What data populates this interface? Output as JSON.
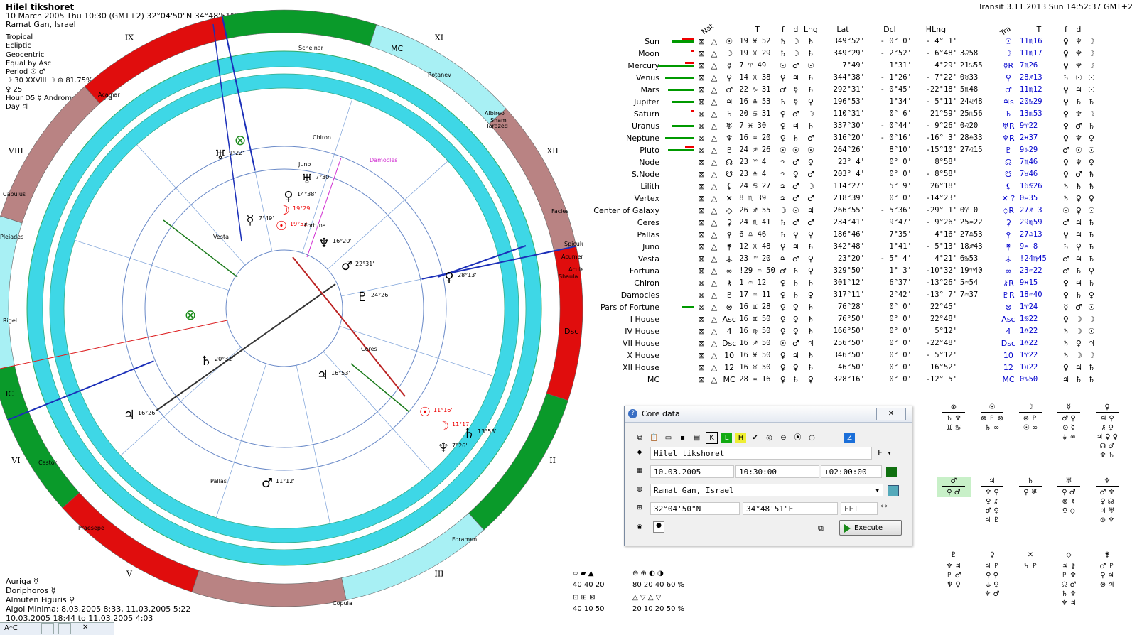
{
  "header": {
    "name": "Hilel tikshoret",
    "datetime": "10 March 2005   Thu   10:30 (GMT+2) 32°04'50\"N   34°48'51\"E",
    "place": "Ramat Gan, Israel"
  },
  "settings": [
    "Tropical",
    "Ecliptic",
    "Geocentric",
    "Equal by Asc",
    "Period ☉ ♂",
    "☽ 30 XXVIII ☽ ⊕ 81.75%",
    "♀ 25",
    "Hour D5 ☿ Andromeda Nebula",
    "Day ♃"
  ],
  "transit_label": "Transit  3.11.2013  Sun 14:52:37 GMT+2",
  "bottom_info": [
    "Auriga ☿",
    "Doriphoros ☿",
    "Almuten Figuris ♀",
    "Algol Minima: 8.03.2005  8:33,  11.03.2005  5:22",
    "10.03.2005 18:44 to 11.03.2005  4:03"
  ],
  "taskbar_label": "A*C",
  "chart": {
    "house_labels": [
      "X",
      "XI",
      "XII",
      "I",
      "II",
      "III",
      "IV",
      "V",
      "VI",
      "VII",
      "VIII",
      "IX"
    ],
    "angle_labels": {
      "mc": "MC",
      "ic": "IC",
      "dsc": "Dsc"
    },
    "planets": [
      {
        "glyph": "☉",
        "deg": "19°52'",
        "color": "#e00"
      },
      {
        "glyph": "☽",
        "deg": "19°29'",
        "color": "#e00"
      },
      {
        "glyph": "☿",
        "deg": "7°49'",
        "color": "#000"
      },
      {
        "glyph": "♀",
        "deg": "14°38'",
        "color": "#000"
      },
      {
        "glyph": "♂",
        "deg": "22°31'",
        "color": "#000"
      },
      {
        "glyph": "♃",
        "deg": "16°53'",
        "color": "#000"
      },
      {
        "glyph": "♄",
        "deg": "20°31'",
        "color": "#000"
      },
      {
        "glyph": "♅",
        "deg": "7°30'",
        "color": "#000"
      },
      {
        "glyph": "♆",
        "deg": "16°20'",
        "color": "#000"
      },
      {
        "glyph": "♇",
        "deg": "24°26'",
        "color": "#000"
      }
    ],
    "transits": [
      {
        "glyph": "☉",
        "deg": "11°16'",
        "color": "#e00"
      },
      {
        "glyph": "☽",
        "deg": "11°17'",
        "color": "#e00"
      },
      {
        "glyph": "♄",
        "deg": "13°53'",
        "color": "#000"
      },
      {
        "glyph": "♀",
        "deg": "28°13'",
        "color": "#000"
      },
      {
        "glyph": "♃",
        "deg": "16°26'",
        "color": "#000"
      },
      {
        "glyph": "♂",
        "deg": "11°12'",
        "color": "#000"
      },
      {
        "glyph": "♆",
        "deg": "7°26'",
        "color": "#000"
      },
      {
        "glyph": "♅",
        "deg": "9°22'",
        "color": "#000"
      }
    ],
    "points": [
      "Chiron",
      "Juno",
      "Damocles",
      "Vesta",
      "Fortuna",
      "Pallas",
      "Ceres",
      "Acamar",
      "Scheinar",
      "Rotanev",
      "Albireo",
      "Sham",
      "Tarazed",
      "Facies",
      "Spiculum",
      "Acumen",
      "Aculeus",
      "Shaula",
      "Capulus",
      "Pleiades",
      "Rigel",
      "Castor",
      "Praesepe",
      "Foramen",
      "Copula"
    ]
  },
  "table": {
    "headers": {
      "nat": "Nat",
      "t": "T",
      "f": "f",
      "d": "d",
      "lng": "Lng",
      "lat": "Lat",
      "dcl": "Dcl",
      "hlng": "HLng",
      "tra": "Tra",
      "t2": "T",
      "f2": "f",
      "d2": "d"
    },
    "rows": [
      {
        "name": "Sun",
        "g": "☉",
        "lng": "19 ♓ 52",
        "t": "♄",
        "f": "☽",
        "d": "♄",
        "elng": "349°52'",
        "lat": "- 0° 0'",
        "dcl": "- 4° 1'",
        "hl": "",
        "tg": "☉",
        "tr": "11♏16",
        "t2": "♀",
        "f2": "♆",
        "d2": "☽",
        "gr": 30,
        "rd": 16
      },
      {
        "name": "Moon",
        "g": "☽",
        "lng": "19 ♓ 29",
        "t": "♄",
        "f": "☽",
        "d": "♄",
        "elng": "349°29'",
        "lat": "- 2°52'",
        "dcl": "- 6°48'",
        "hl": "3♌58",
        "tg": "☽",
        "tr": "11♏17",
        "t2": "♀",
        "f2": "♆",
        "d2": "☽",
        "gr": 0,
        "rd": 3
      },
      {
        "name": "Mercury",
        "g": "☿",
        "lng": "7 ♈ 49",
        "t": "☉",
        "f": "♂",
        "d": "☉",
        "elng": "7°49'",
        "lat": "1°31'",
        "dcl": "4°29'",
        "hl": "21♋55",
        "tg": "☿R",
        "tr": "7♏26",
        "t2": "♀",
        "f2": "♆",
        "d2": "☽",
        "gr": 50,
        "rd": 12
      },
      {
        "name": "Venus",
        "g": "♀",
        "lng": "14 ♓ 38",
        "t": "♀",
        "f": "♃",
        "d": "♄",
        "elng": "344°38'",
        "lat": "- 1°26'",
        "dcl": "- 7°22'",
        "hl": "0♉33",
        "tg": "♀",
        "tr": "28♐13",
        "t2": "♄",
        "f2": "☉",
        "d2": "☉",
        "gr": 40,
        "rd": 0
      },
      {
        "name": "Mars",
        "g": "♂",
        "lng": "22 ♑ 31",
        "t": "♂",
        "f": "☿",
        "d": "♄",
        "elng": "292°31'",
        "lat": "- 0°45'",
        "dcl": "-22°18'",
        "hl": "5♏48",
        "tg": "♂",
        "tr": "11♍12",
        "t2": "♀",
        "f2": "♃",
        "d2": "☉",
        "gr": 36,
        "rd": 0
      },
      {
        "name": "Jupiter",
        "g": "♃",
        "lng": "16 ♎ 53",
        "t": "♄",
        "f": "☿",
        "d": "♀",
        "elng": "196°53'",
        "lat": "1°34'",
        "dcl": "- 5°11'",
        "hl": "24♌48",
        "tg": "♃s",
        "tr": "20♋29",
        "t2": "♀",
        "f2": "♄",
        "d2": "♄",
        "gr": 30,
        "rd": 0
      },
      {
        "name": "Saturn",
        "g": "♄",
        "lng": "20 ♋ 31",
        "t": "♀",
        "f": "♂",
        "d": "☽",
        "elng": "110°31'",
        "lat": "0° 6'",
        "dcl": "21°59'",
        "hl": "25♏56",
        "tg": "♄",
        "tr": "13♏53",
        "t2": "♀",
        "f2": "♆",
        "d2": "☽",
        "gr": 0,
        "rd": 4
      },
      {
        "name": "Uranus",
        "g": "♅",
        "lng": "7 ♓ 30",
        "t": "♀",
        "f": "♃",
        "d": "♄",
        "elng": "337°30'",
        "lat": "- 0°44'",
        "dcl": "- 9°26'",
        "hl": "0♌20",
        "tg": "♅R",
        "tr": "9♈22",
        "t2": "♀",
        "f2": "♂",
        "d2": "♄",
        "gr": 30,
        "rd": 0
      },
      {
        "name": "Neptune",
        "g": "♆",
        "lng": "16 ♒ 20",
        "t": "♀",
        "f": "♄",
        "d": "♂",
        "elng": "316°20'",
        "lat": "- 0°16'",
        "dcl": "-16° 3'",
        "hl": "28♎33",
        "tg": "♆R",
        "tr": "2♓37",
        "t2": "♀",
        "f2": "♆",
        "d2": "♀",
        "gr": 40,
        "rd": 0
      },
      {
        "name": "Pluto",
        "g": "♇",
        "lng": "24 ♐ 26",
        "t": "☉",
        "f": "☉",
        "d": "☉",
        "elng": "264°26'",
        "lat": "8°10'",
        "dcl": "-15°10'",
        "hl": "27♌15",
        "tg": "♇",
        "tr": "9♑29",
        "t2": "♂",
        "f2": "☉",
        "d2": "☉",
        "gr": 36,
        "rd": 12
      },
      {
        "name": "Node",
        "g": "☊",
        "lng": "23 ♈ 4",
        "t": "♃",
        "f": "♂",
        "d": "♀",
        "elng": "23° 4'",
        "lat": "0° 0'",
        "dcl": "8°58'",
        "hl": "",
        "tg": "☊",
        "tr": "7♏46",
        "t2": "♀",
        "f2": "♆",
        "d2": "♀",
        "gr": 0,
        "rd": 0
      },
      {
        "name": "S.Node",
        "g": "☋",
        "lng": "23 ♎ 4",
        "t": "♃",
        "f": "♀",
        "d": "♂",
        "elng": "203° 4'",
        "lat": "0° 0'",
        "dcl": "- 8°58'",
        "hl": "",
        "tg": "☋",
        "tr": "7♉46",
        "t2": "♀",
        "f2": "♂",
        "d2": "♄",
        "gr": 0,
        "rd": 0
      },
      {
        "name": "Lilith",
        "g": "⚸",
        "lng": "24 ♋ 27",
        "t": "♃",
        "f": "♂",
        "d": "☽",
        "elng": "114°27'",
        "lat": "5° 9'",
        "dcl": "26°18'",
        "hl": "",
        "tg": "⚸",
        "tr": "16♋26",
        "t2": "♄",
        "f2": "♄",
        "d2": "♄",
        "gr": 0,
        "rd": 0
      },
      {
        "name": "Vertex",
        "g": "✕",
        "lng": "8 ♏ 39",
        "t": "♃",
        "f": "♂",
        "d": "♂",
        "elng": "218°39'",
        "lat": "0° 0'",
        "dcl": "-14°23'",
        "hl": "",
        "tg": "✕ ?",
        "tr": "0♒35",
        "t2": "♄",
        "f2": "♀",
        "d2": "♀",
        "gr": 0,
        "rd": 0
      },
      {
        "name": "Center of Galaxy",
        "g": "◇",
        "lng": "26 ♐ 55",
        "t": "☽",
        "f": "☉",
        "d": "♃",
        "elng": "266°55'",
        "lat": "- 5°36'",
        "dcl": "-29° 1'",
        "hl": "0♈ 0",
        "tg": "◇R",
        "tr": "27♐ 3",
        "t2": "☉",
        "f2": "♀",
        "d2": "☉",
        "gr": 0,
        "rd": 0
      },
      {
        "name": "Ceres",
        "g": "⚳",
        "lng": "24 ♏ 41",
        "t": "♄",
        "f": "♂",
        "d": "♂",
        "elng": "234°41'",
        "lat": "9°47'",
        "dcl": "- 9°26'",
        "hl": "25♒22",
        "tg": "⚳",
        "tr": "29♍59",
        "t2": "♂",
        "f2": "♃",
        "d2": "♄",
        "gr": 0,
        "rd": 0
      },
      {
        "name": "Pallas",
        "g": "⚴",
        "lng": "6 ♎ 46",
        "t": "♄",
        "f": "♀",
        "d": "♀",
        "elng": "186°46'",
        "lat": "7°35'",
        "dcl": "4°16'",
        "hl": "27♎53",
        "tg": "⚴",
        "tr": "27♎13",
        "t2": "♀",
        "f2": "♃",
        "d2": "♄",
        "gr": 0,
        "rd": 0
      },
      {
        "name": "Juno",
        "g": "⚵",
        "lng": "12 ♓ 48",
        "t": "♀",
        "f": "♃",
        "d": "♄",
        "elng": "342°48'",
        "lat": "1°41'",
        "dcl": "- 5°13'",
        "hl": "18♐43",
        "tg": "⚵",
        "tr": "9♒ 8",
        "t2": "♄",
        "f2": "♀",
        "d2": "♄",
        "gr": 0,
        "rd": 0
      },
      {
        "name": "Vesta",
        "g": "⚶",
        "lng": "23 ♈ 20",
        "t": "♃",
        "f": "♂",
        "d": "♀",
        "elng": "23°20'",
        "lat": "- 5° 4'",
        "dcl": "4°21'",
        "hl": "6♋53",
        "tg": "⚶",
        "tr": "!24♍45",
        "t2": "♂",
        "f2": "♃",
        "d2": "♄",
        "gr": 0,
        "rd": 0
      },
      {
        "name": "Fortuna",
        "g": "∞",
        "lng": "!29 ♒ 50",
        "t": "♂",
        "f": "♄",
        "d": "♀",
        "elng": "329°50'",
        "lat": "1° 3'",
        "dcl": "-10°32'",
        "hl": "19♈40",
        "tg": "∞",
        "tr": "23♒22",
        "t2": "♂",
        "f2": "♄",
        "d2": "♀",
        "gr": 0,
        "rd": 0
      },
      {
        "name": "Chiron",
        "g": "⚷",
        "lng": "1 ♒ 12",
        "t": "♀",
        "f": "♄",
        "d": "♄",
        "elng": "301°12'",
        "lat": "6°37'",
        "dcl": "-13°26'",
        "hl": "5♒54",
        "tg": "⚷R",
        "tr": "9♓15",
        "t2": "♀",
        "f2": "♃",
        "d2": "♄",
        "gr": 0,
        "rd": 0
      },
      {
        "name": "Damocles",
        "g": "♇",
        "lng": "17 ♒ 11",
        "t": "♀",
        "f": "♄",
        "d": "♀",
        "elng": "317°11'",
        "lat": "2°42'",
        "dcl": "-13° 7'",
        "hl": "7♒37",
        "tg": "♇R",
        "tr": "18♒40",
        "t2": "♀",
        "f2": "♄",
        "d2": "♀",
        "gr": 0,
        "rd": 0
      },
      {
        "name": "Pars of Fortune",
        "g": "⊗",
        "lng": "16 ♊ 28",
        "t": "♀",
        "f": "♀",
        "d": "♄",
        "elng": "76°28'",
        "lat": "0° 0'",
        "dcl": "22°45'",
        "hl": "",
        "tg": "⊗",
        "tr": "1♈24",
        "t2": "☿",
        "f2": "♂",
        "d2": "☉",
        "gr": 16,
        "rd": 0
      },
      {
        "name": "I House",
        "g": "Asc",
        "lng": "16 ♊ 50",
        "t": "♀",
        "f": "♀",
        "d": "♄",
        "elng": "76°50'",
        "lat": "0° 0'",
        "dcl": "22°48'",
        "hl": "",
        "tg": "Asc",
        "tr": "1♋22",
        "t2": "♀",
        "f2": "☽",
        "d2": "☽",
        "gr": 0,
        "rd": 0
      },
      {
        "name": "IV House",
        "g": "4",
        "lng": "16 ♍ 50",
        "t": "♀",
        "f": "♀",
        "d": "♄",
        "elng": "166°50'",
        "lat": "0° 0'",
        "dcl": "5°12'",
        "hl": "",
        "tg": "4",
        "tr": "1♎22",
        "t2": "♄",
        "f2": "☽",
        "d2": "☉",
        "gr": 0,
        "rd": 0
      },
      {
        "name": "VII House",
        "g": "Dsc",
        "lng": "16 ♐ 50",
        "t": "☉",
        "f": "♂",
        "d": "♃",
        "elng": "256°50'",
        "lat": "0° 0'",
        "dcl": "-22°48'",
        "hl": "",
        "tg": "Dsc",
        "tr": "1♎22",
        "t2": "♄",
        "f2": "♀",
        "d2": "♃",
        "gr": 0,
        "rd": 0
      },
      {
        "name": "X House",
        "g": "10",
        "lng": "16 ♓ 50",
        "t": "♀",
        "f": "♃",
        "d": "♄",
        "elng": "346°50'",
        "lat": "0° 0'",
        "dcl": "- 5°12'",
        "hl": "",
        "tg": "10",
        "tr": "1♈22",
        "t2": "♄",
        "f2": "☽",
        "d2": "☽",
        "gr": 0,
        "rd": 0
      },
      {
        "name": "XII House",
        "g": "12",
        "lng": "16 ♉ 50",
        "t": "♀",
        "f": "♀",
        "d": "♄",
        "elng": "46°50'",
        "lat": "0° 0'",
        "dcl": "16°52'",
        "hl": "",
        "tg": "12",
        "tr": "1♓22",
        "t2": "♀",
        "f2": "♃",
        "d2": "♄",
        "gr": 0,
        "rd": 0
      },
      {
        "name": "MC",
        "g": "MC",
        "lng": "28 ♒ 16",
        "t": "♀",
        "f": "♄",
        "d": "♀",
        "elng": "328°16'",
        "lat": "0° 0'",
        "dcl": "-12° 5'",
        "hl": "",
        "tg": "MC",
        "tr": "0♑50",
        "t2": "♃",
        "f2": "♄",
        "d2": "♄",
        "gr": 0,
        "rd": 0
      }
    ]
  },
  "dialog": {
    "title": "Core data",
    "close": "✕",
    "name": "Hilel tikshoret",
    "gender": "F",
    "date": "10.03.2005",
    "time": "10:30:00",
    "tz": "+02:00:00",
    "place": "Ramat Gan, Israel",
    "lat": "32°04'50\"N",
    "lon": "34°48'51\"E",
    "zone": "EET",
    "execute": "Execute"
  },
  "stats": [
    "40  40  20",
    "80  20  40  60 %",
    "40  10  50",
    "20  10  20  50 %"
  ],
  "aspect_grid": [
    {
      "head": "⊗",
      "lines": [
        "♄ ♆",
        "♊ ♋"
      ]
    },
    {
      "head": "☉",
      "lines": [
        "⊗ ♇ ⊗",
        "♄ ∞"
      ]
    },
    {
      "head": "☽",
      "lines": [
        "⊗ ♇",
        "☉ ∞"
      ]
    },
    {
      "head": "☿",
      "lines": [
        "♂ ♀",
        "⊙ ☿",
        "⚶ ∞"
      ]
    },
    {
      "head": "♀",
      "lines": [
        "♃ ♀",
        "⚷ ♀",
        "♃ ♀ ♀",
        "☊ ♂",
        "♆ ♄"
      ]
    },
    {
      "head": "♂",
      "lines": [
        "♀ ♂"
      ]
    },
    {
      "head": "♃",
      "lines": [
        "♆ ♀",
        "♀ ⚷",
        "♂ ♀",
        "♃ ♇"
      ]
    },
    {
      "head": "♄",
      "lines": [
        "♀ ♅"
      ]
    },
    {
      "head": "♅",
      "lines": [
        "♀ ♂",
        "⊗ ⚷",
        "♀ ◇"
      ]
    },
    {
      "head": "♆",
      "lines": [
        "♂ ♆",
        "♀ ☊",
        "♃ ♅",
        "⊙ ♆"
      ]
    },
    {
      "head": "♇",
      "lines": [
        "♆ ♃",
        "♇ ♂",
        "♆ ♀"
      ]
    },
    {
      "head": "⚳",
      "lines": [
        "♃ ♇",
        "♀ ♀",
        "⚶ ♀",
        "♆ ♂"
      ]
    },
    {
      "head": "✕",
      "lines": [
        "♄ ♇"
      ]
    },
    {
      "head": "◇",
      "lines": [
        "♃ ⚷",
        "♇ ♆",
        "☊ ♂",
        "♄ ♆",
        "♆ ♃"
      ]
    },
    {
      "head": "⚵",
      "lines": [
        "♂ ♇",
        "♀ ♃",
        "⊗ ♃"
      ]
    }
  ]
}
